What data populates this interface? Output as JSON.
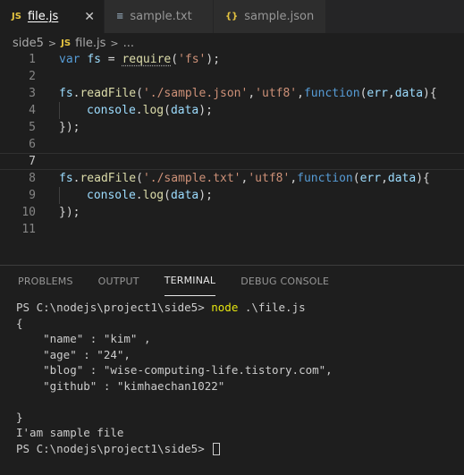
{
  "tabs": [
    {
      "icon": "JS",
      "label": "file.js",
      "active": true,
      "close": "✕"
    },
    {
      "icon": "≡",
      "label": "sample.txt",
      "active": false
    },
    {
      "icon": "{}",
      "label": "sample.json",
      "active": false
    }
  ],
  "breadcrumb": {
    "folder": "side5",
    "file_icon": "JS",
    "file": "file.js",
    "more": "..."
  },
  "editor": {
    "line_numbers": [
      "1",
      "2",
      "3",
      "4",
      "5",
      "6",
      "7",
      "8",
      "9",
      "10",
      "11"
    ],
    "current_line": 7,
    "tokens": {
      "var": "var",
      "fs": "fs",
      "eq": " = ",
      "require": "require",
      "fs_str": "'fs'",
      "semi": ";",
      "fs_obj": "fs",
      "dot": ".",
      "readFile": "readFile",
      "json_path": "'./sample.json'",
      "txt_path": "'./sample.txt'",
      "utf8": "'utf8'",
      "function_kw": "function",
      "err": "err",
      "data": "data",
      "console": "console",
      "log": "log",
      "close": "});"
    }
  },
  "panel": {
    "tabs": [
      "PROBLEMS",
      "OUTPUT",
      "TERMINAL",
      "DEBUG CONSOLE"
    ],
    "active_tab": "TERMINAL"
  },
  "terminal": {
    "prompt": "PS C:\\nodejs\\project1\\side5> ",
    "command": "node",
    "args": " .\\file.js",
    "output": [
      "{",
      "    \"name\" : \"kim\" ,",
      "    \"age\" : \"24\",",
      "    \"blog\" : \"wise-computing-life.tistory.com\",",
      "    \"github\" : \"kimhaechan1022\"",
      "",
      "}",
      "I'am sample file"
    ],
    "final_prompt": "PS C:\\nodejs\\project1\\side5> "
  }
}
